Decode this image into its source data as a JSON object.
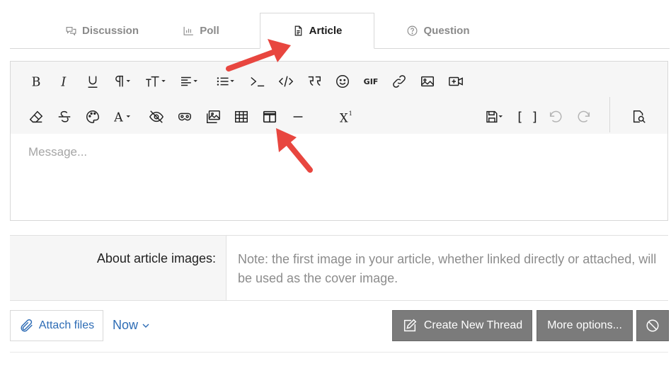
{
  "tabs": [
    {
      "label": "Discussion",
      "icon": "chat-bubbles-icon"
    },
    {
      "label": "Poll",
      "icon": "bar-chart-icon"
    },
    {
      "label": "Article",
      "icon": "document-icon",
      "active": true
    },
    {
      "label": "Question",
      "icon": "question-circle-icon"
    }
  ],
  "toolbar": {
    "row1": [
      "bold-icon",
      "italic-icon",
      "underline-icon",
      "paragraph-icon",
      "text-size-icon",
      "align-icon",
      "list-icon",
      "code-inline-icon",
      "code-icon",
      "quote-icon",
      "smiley-icon",
      "gif-icon",
      "link-icon",
      "image-icon",
      "video-icon"
    ],
    "row2": [
      "eraser-icon",
      "strikethrough-icon",
      "palette-icon",
      "font-color-icon",
      "hide-icon",
      "spoiler-icon",
      "gallery-icon",
      "table-icon",
      "layout-columns-icon",
      "horizontal-rule-icon",
      "superscript-icon",
      "drafts-icon",
      "bbcode-icon",
      "undo-icon",
      "redo-icon",
      "preview-icon"
    ],
    "gif_label": "GIF",
    "bbcode_label": "[ ]"
  },
  "editor": {
    "placeholder": "Message..."
  },
  "about": {
    "label": "About article images:",
    "note": "Note: the first image in your article, whether linked directly or attached, will be used as the cover image."
  },
  "actions": {
    "attach_label": "Attach files",
    "now_label": "Now",
    "create_label": "Create New Thread",
    "more_label": "More options..."
  },
  "colors": {
    "link": "#2d6cb5",
    "button": "#7b7b7b",
    "arrow": "#e8463f"
  }
}
